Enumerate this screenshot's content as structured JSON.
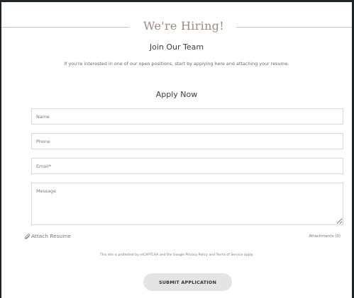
{
  "header": {
    "title": "We're Hiring!",
    "subtitle": "Join Our Team",
    "intro": "If you're interested in one of our open positions, start by applying here and attaching your resume."
  },
  "form": {
    "title": "Apply Now",
    "name_placeholder": "Name",
    "phone_placeholder": "Phone",
    "email_placeholder": "Email*",
    "message_placeholder": "Message",
    "attach_label": "Attach Resume",
    "attach_icon": "paperclip-icon",
    "attachments_count": "Attachments (0)",
    "recaptcha_text": "This site is protected by reCAPTCHA and the Google Privacy Policy and Terms of Service apply.",
    "submit_label": "SUBMIT APPLICATION"
  },
  "colors": {
    "title_accent": "#9b8b80",
    "frame_border": "#1e2529",
    "button_bg": "#e4e4e4"
  }
}
